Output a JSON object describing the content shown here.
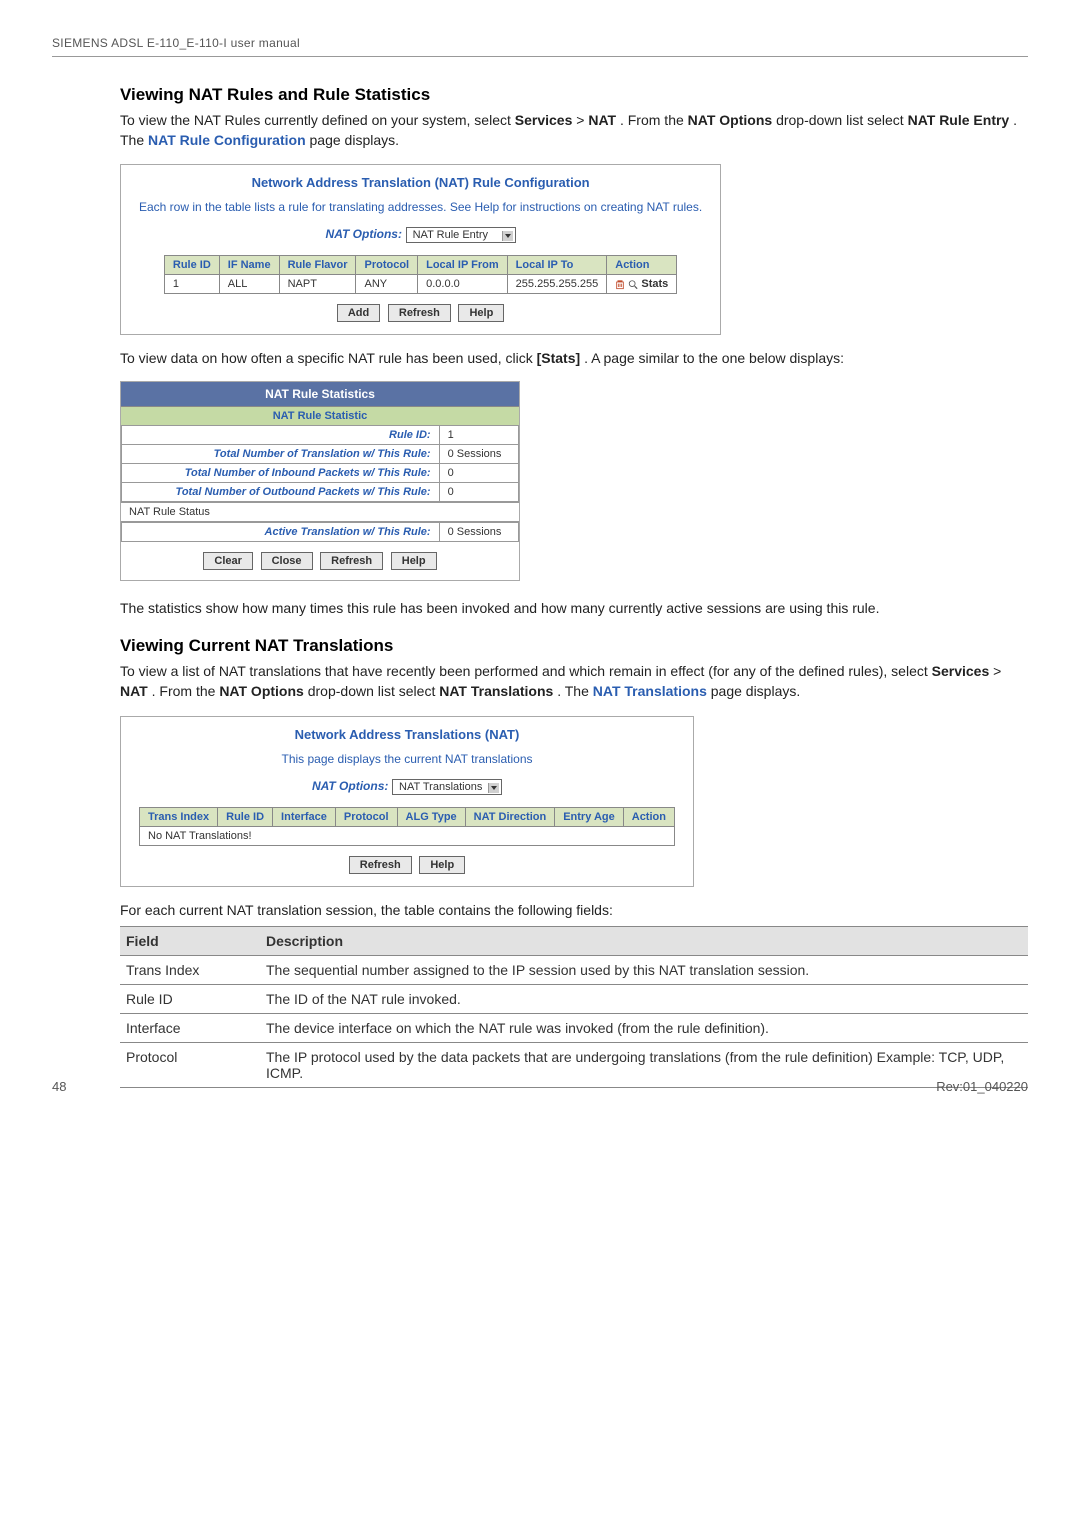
{
  "page_header": "SIEMENS ADSL E-110_E-110-I user manual",
  "section1": {
    "title": "Viewing NAT Rules and Rule Statistics",
    "p1_a": "To view the NAT Rules currently defined on your system, select ",
    "p1_services": "Services",
    "p1_gt": " > ",
    "p1_nat": "NAT",
    "p1_b": ". From the ",
    "p1_natopts": "NAT Options",
    "p1_c": " drop-down list select ",
    "p1_ruleentry": "NAT Rule Entry",
    "p1_d": ". The ",
    "p1_link": "NAT Rule Configuration",
    "p1_e": " page displays."
  },
  "panel1": {
    "title": "Network Address Translation (NAT) Rule Configuration",
    "caption": "Each row in the table lists a rule for translating addresses. See Help for instructions on creating NAT rules.",
    "opts_label": "NAT Options:",
    "opts_value": "NAT Rule Entry",
    "cols": [
      "Rule ID",
      "IF Name",
      "Rule Flavor",
      "Protocol",
      "Local IP From",
      "Local IP To",
      "Action"
    ],
    "row": {
      "id": "1",
      "if": "ALL",
      "flavor": "NAPT",
      "proto": "ANY",
      "from": "0.0.0.0",
      "to": "255.255.255.255",
      "action_stats": "Stats"
    },
    "buttons": [
      "Add",
      "Refresh",
      "Help"
    ]
  },
  "section1b": {
    "p2_a": "To view data on how often a specific NAT rule has been used, click ",
    "p2_stats": "[Stats]",
    "p2_b": ". A page similar to the one below displays:"
  },
  "stats": {
    "title": "NAT Rule Statistics",
    "subtitle": "NAT Rule Statistic",
    "rows": [
      {
        "label": "Rule ID:",
        "value": "1"
      },
      {
        "label": "Total Number of Translation w/ This Rule:",
        "value": "0 Sessions"
      },
      {
        "label": "Total Number of Inbound Packets w/ This Rule:",
        "value": "0"
      },
      {
        "label": "Total Number of Outbound Packets w/ This Rule:",
        "value": "0"
      }
    ],
    "status_section": "NAT Rule Status",
    "status_row": {
      "label": "Active Translation w/ This Rule:",
      "value": "0 Sessions"
    },
    "buttons": [
      "Clear",
      "Close",
      "Refresh",
      "Help"
    ]
  },
  "section1c": "The statistics show how many times this rule has been invoked and how many currently active sessions are using this rule.",
  "section2": {
    "title": "Viewing Current NAT Translations",
    "p_a": "To view a list of NAT translations that have recently been performed and which remain in effect (for any of the defined rules), select ",
    "p_services": "Services",
    "p_gt": " > ",
    "p_nat": "NAT",
    "p_b": ". From the ",
    "p_natopts": "NAT Options",
    "p_c": " drop-down list select ",
    "p_nattrans": "NAT Translations",
    "p_d": ". The ",
    "p_link": "NAT Translations",
    "p_e": " page displays."
  },
  "panel3": {
    "title": "Network Address Translations (NAT)",
    "caption": "This page displays the current NAT translations",
    "opts_label": "NAT Options:",
    "opts_value": "NAT Translations",
    "cols": [
      "Trans Index",
      "Rule ID",
      "Interface",
      "Protocol",
      "ALG Type",
      "NAT Direction",
      "Entry Age",
      "Action"
    ],
    "empty": "No NAT Translations!",
    "buttons": [
      "Refresh",
      "Help"
    ]
  },
  "ftable": {
    "caption": "For each current NAT translation session, the table contains the following fields:",
    "head": {
      "field": "Field",
      "desc": "Description"
    },
    "rows": [
      {
        "field": "Trans Index",
        "desc": "The sequential number assigned to the IP session used by this NAT translation session."
      },
      {
        "field": "Rule ID",
        "desc": "The ID of the NAT rule invoked."
      },
      {
        "field": "Interface",
        "desc": "The device interface on which the NAT rule was invoked (from the rule definition)."
      },
      {
        "field": "Protocol",
        "desc": "The IP protocol used by the data packets that are undergoing translations (from the rule definition) Example: TCP, UDP, ICMP."
      }
    ]
  },
  "footer": {
    "left": "48",
    "right": "Rev:01_040220"
  }
}
